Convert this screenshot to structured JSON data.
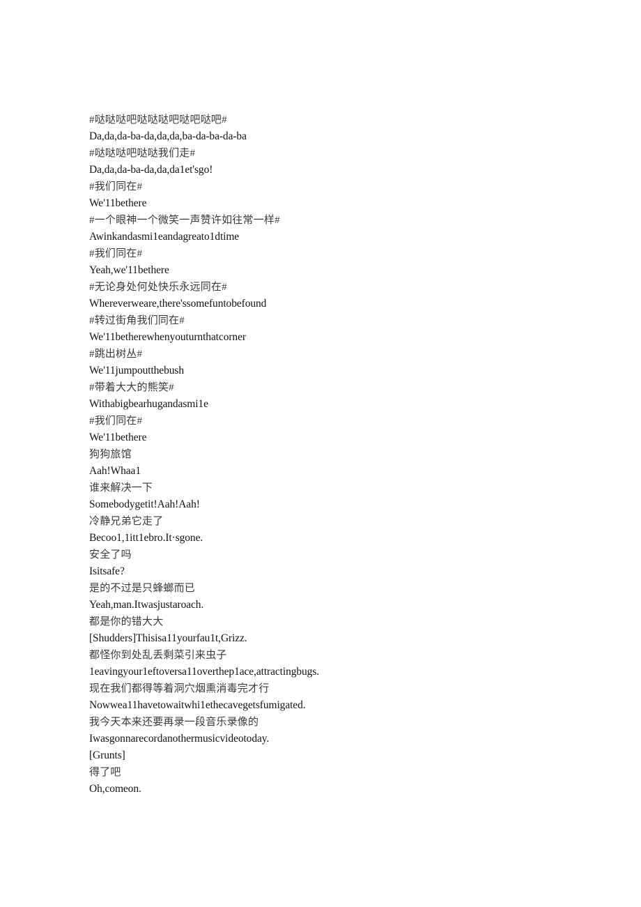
{
  "document": {
    "type": "bilingual-subtitle-transcript",
    "page_background": "#ffffff",
    "text_color": "#1a1a1a",
    "lines": [
      {
        "lang": "zh",
        "text": "#哒哒哒吧哒哒哒吧哒吧哒吧#"
      },
      {
        "lang": "en",
        "text": "Da,da,da-ba-da,da,da,ba-da-ba-da-ba"
      },
      {
        "lang": "zh",
        "text": "#哒哒哒吧哒哒我们走#"
      },
      {
        "lang": "en",
        "text": "Da,da,da-ba-da,da,da1et'sgo!"
      },
      {
        "lang": "zh",
        "text": "#我们同在#"
      },
      {
        "lang": "en",
        "text": "We'11bethere"
      },
      {
        "lang": "zh",
        "text": "#一个眼神一个微笑一声赞许如往常一样#"
      },
      {
        "lang": "en",
        "text": "Awinkandasmi1eandagreato1dtime"
      },
      {
        "lang": "zh",
        "text": "#我们同在#"
      },
      {
        "lang": "en",
        "text": "Yeah,we'11bethere"
      },
      {
        "lang": "zh",
        "text": "#无论身处何处快乐永远同在#"
      },
      {
        "lang": "en",
        "text": "Whereverweare,there'ssomefuntobefound"
      },
      {
        "lang": "zh",
        "text": "#转过街角我们同在#"
      },
      {
        "lang": "en",
        "text": "We'11betherewhenyouturnthatcorner"
      },
      {
        "lang": "zh",
        "text": "#跳出树丛#"
      },
      {
        "lang": "en",
        "text": "We'11jumpoutthebush"
      },
      {
        "lang": "zh",
        "text": "#带着大大的熊笑#"
      },
      {
        "lang": "en",
        "text": "Withabigbearhugandasmi1e"
      },
      {
        "lang": "zh",
        "text": "#我们同在#"
      },
      {
        "lang": "en",
        "text": "We'11bethere"
      },
      {
        "lang": "zh",
        "text": "狗狗旅馆"
      },
      {
        "lang": "en",
        "text": "Aah!Whaa1"
      },
      {
        "lang": "zh",
        "text": "谁来解决一下"
      },
      {
        "lang": "en",
        "text": "Somebodygetit!Aah!Aah!"
      },
      {
        "lang": "zh",
        "text": "冷静兄弟它走了"
      },
      {
        "lang": "en",
        "text": "Becoo1,1itt1ebro.It·sgone."
      },
      {
        "lang": "zh",
        "text": "安全了吗"
      },
      {
        "lang": "en",
        "text": "Isitsafe?"
      },
      {
        "lang": "zh",
        "text": "是的不过是只蜂螂而已"
      },
      {
        "lang": "en",
        "text": "Yeah,man.Itwasjustaroach."
      },
      {
        "lang": "zh",
        "text": "都是你的错大大"
      },
      {
        "lang": "en",
        "text": "[Shudders]Thisisa11yourfau1t,Grizz."
      },
      {
        "lang": "zh",
        "text": "都怪你到处乱丢剩菜引来虫子"
      },
      {
        "lang": "en",
        "text": "1eavingyour1eftoversa11overthep1ace,attractingbugs."
      },
      {
        "lang": "zh",
        "text": "现在我们都得等着洞穴烟熏消毒完才行"
      },
      {
        "lang": "en",
        "text": "Nowwea11havetowaitwhi1ethecavegetsfumigated."
      },
      {
        "lang": "zh",
        "text": "我今天本来还要再录一段音乐录像的"
      },
      {
        "lang": "en",
        "text": "Iwasgonnarecordanothermusicvideotoday."
      },
      {
        "lang": "en",
        "text": "[Grunts]"
      },
      {
        "lang": "zh",
        "text": "得了吧"
      },
      {
        "lang": "en",
        "text": "Oh,comeon."
      }
    ]
  }
}
